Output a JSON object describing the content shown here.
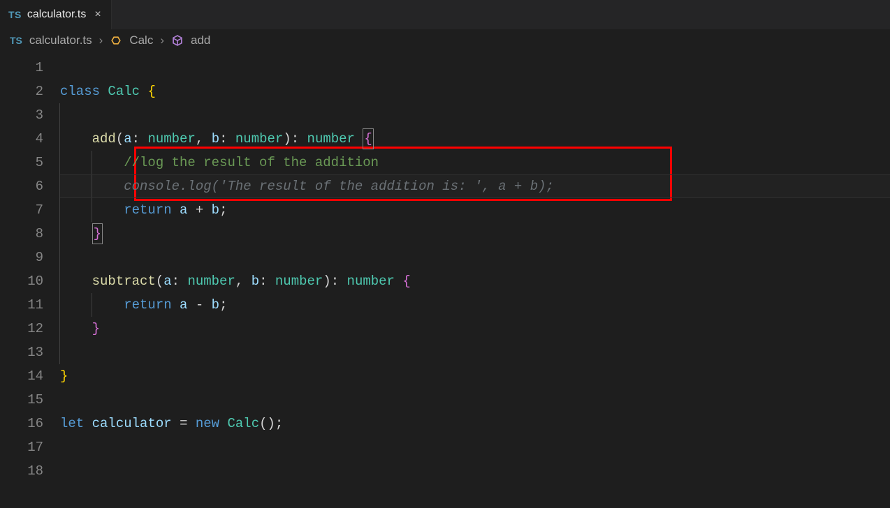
{
  "tab": {
    "icon_label": "TS",
    "label": "calculator.ts"
  },
  "breadcrumb": {
    "icon_label": "TS",
    "file": "calculator.ts",
    "class": "Calc",
    "method": "add"
  },
  "tokens": {
    "kw_class": "class",
    "cls_calc": "Calc",
    "mth_add": "add",
    "mth_subtract": "subtract",
    "var_a": "a",
    "var_b": "b",
    "typ_number": "number",
    "kw_return": "return",
    "kw_let": "let",
    "kw_new": "new",
    "var_calculator": "calculator",
    "comment_line5": "//log the result of the addition",
    "ghost_line6": "console.log('The result of the addition is: ', a + b);"
  },
  "line_numbers": [
    "1",
    "2",
    "3",
    "4",
    "5",
    "6",
    "7",
    "8",
    "9",
    "10",
    "11",
    "12",
    "13",
    "14",
    "15",
    "16",
    "17",
    "18"
  ]
}
